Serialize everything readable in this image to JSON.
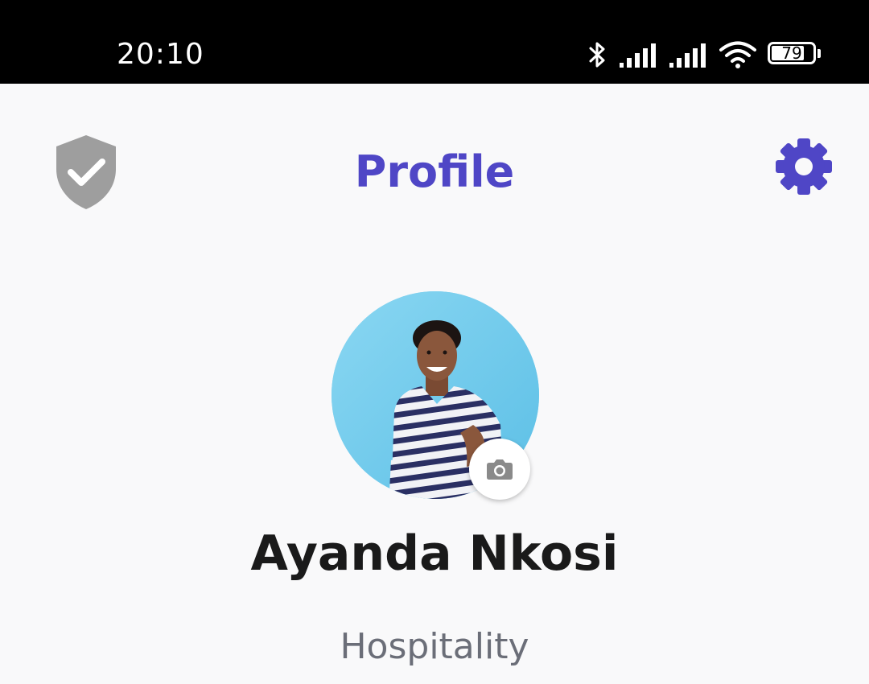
{
  "status_bar": {
    "time": "20:10",
    "battery_percent": 79,
    "battery_label": "79",
    "icons": [
      "bluetooth-icon",
      "signal-icon",
      "signal-icon",
      "wifi-icon",
      "battery-icon"
    ]
  },
  "header": {
    "title": "Profile",
    "left_icon": "shield-check-icon",
    "right_icon": "gear-icon"
  },
  "profile": {
    "name": "Ayanda Nkosi",
    "industry": "Hospitality",
    "avatar_icon": "avatar",
    "camera_icon": "camera-icon"
  },
  "colors": {
    "accent": "#4f46c6",
    "shield": "#9e9e9e",
    "status_bar_bg": "#000000",
    "page_bg": "#f9f9fa",
    "name_text": "#1a1a1a",
    "subtitle_text": "#6b6e78"
  }
}
